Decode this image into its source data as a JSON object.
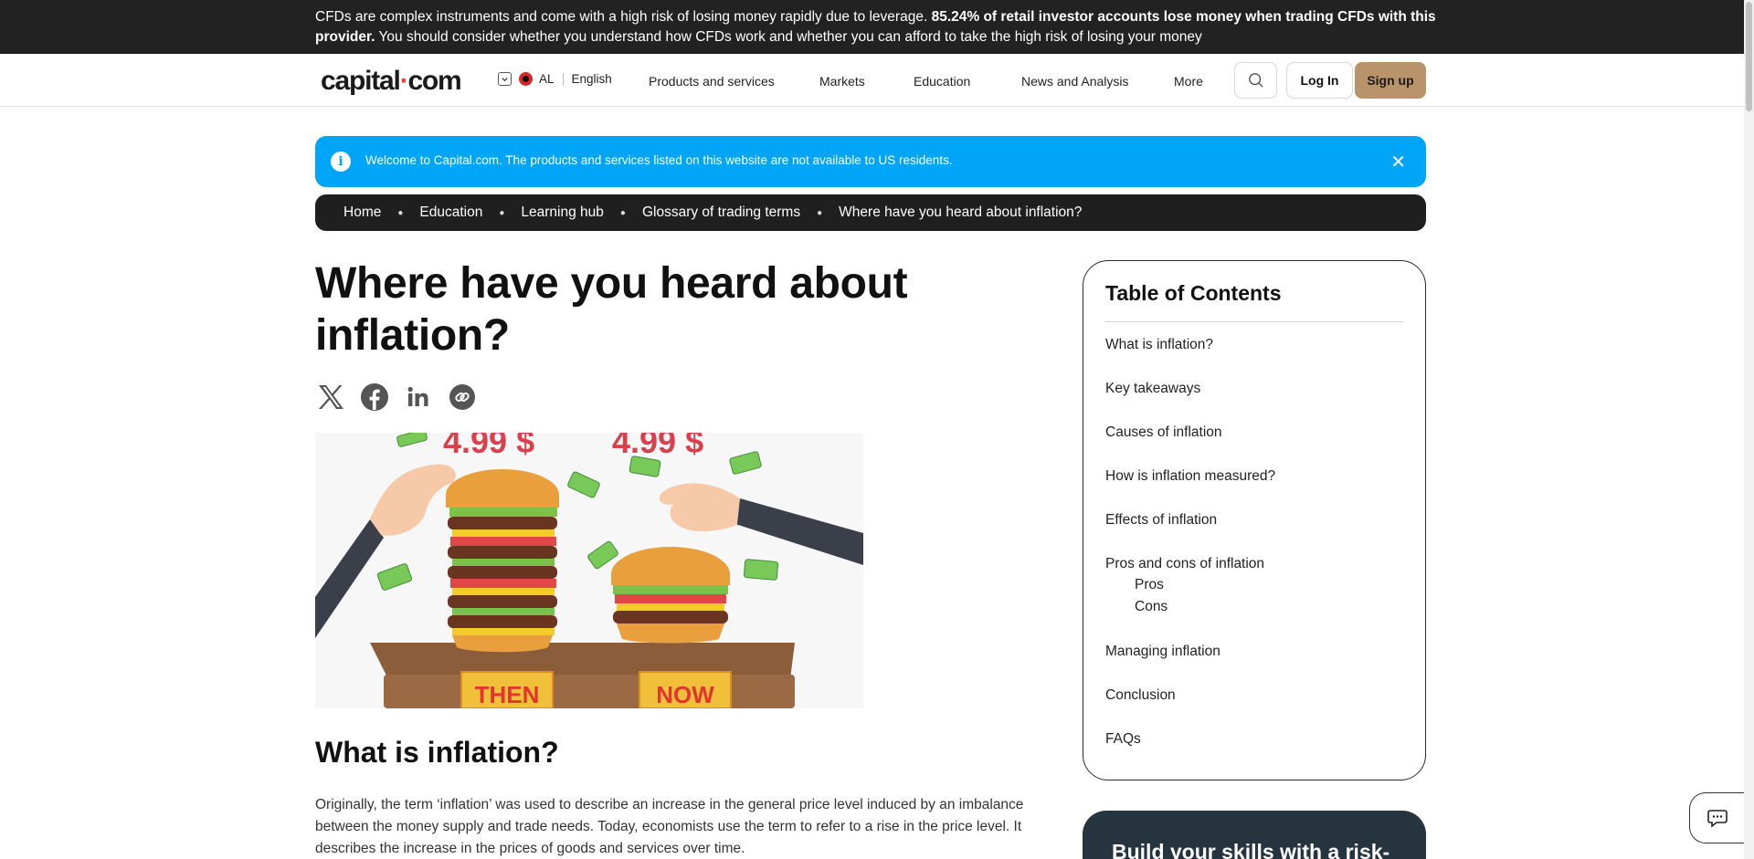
{
  "risk_banner": {
    "text_before": "CFDs are complex instruments and come with a high risk of losing money rapidly due to leverage.",
    "text_bold": "85.24% of retail investor accounts lose money when trading CFDs with this provider.",
    "text_after": "You should consider whether you understand how CFDs work and whether you can afford to take the high risk of losing your money"
  },
  "header": {
    "logo_text_1": "capital",
    "logo_dot": "·",
    "logo_text_2": "com",
    "region": "AL",
    "language": "English",
    "nav": [
      "Products and services",
      "Markets",
      "Education",
      "News and Analysis",
      "More"
    ],
    "login_label": "Log In",
    "signup_label": "Sign up",
    "signup_color": "#b9936a"
  },
  "alert": {
    "message": "Welcome to Capital.com. The products and services listed on this website are not available to US residents.",
    "info_glyph": "i",
    "close_glyph": "✕",
    "color": "#00a5f7"
  },
  "breadcrumb": [
    "Home",
    "Education",
    "Learning hub",
    "Glossary of trading terms",
    "Where have you heard about inflation?"
  ],
  "article": {
    "title": "Where have you heard about inflation?",
    "share_icons": [
      "x-icon",
      "facebook-icon",
      "linkedin-icon",
      "copy-link-icon"
    ],
    "hero": {
      "price_left": "4.99 $",
      "price_right": "4.99 $",
      "sign_left": "THEN",
      "sign_right": "NOW"
    },
    "section_heading": "What is inflation?",
    "paragraph": "Originally, the term ‘inflation’ was used to describe an increase in the general price level induced by an imbalance between the money supply and trade needs. Today, economists use the term to refer to a rise in the price level. It describes the increase in the prices of goods and services over time."
  },
  "toc": {
    "title": "Table of Contents",
    "items": [
      "What is inflation?",
      "Key takeaways",
      "Causes of inflation",
      "How is inflation measured?",
      "Effects of inflation",
      "Pros and cons of inflation"
    ],
    "subitems": [
      "Pros",
      "Cons"
    ],
    "items_after": [
      "Managing inflation",
      "Conclusion",
      "FAQs"
    ]
  },
  "promo": {
    "title": "Build your skills with a risk-"
  }
}
